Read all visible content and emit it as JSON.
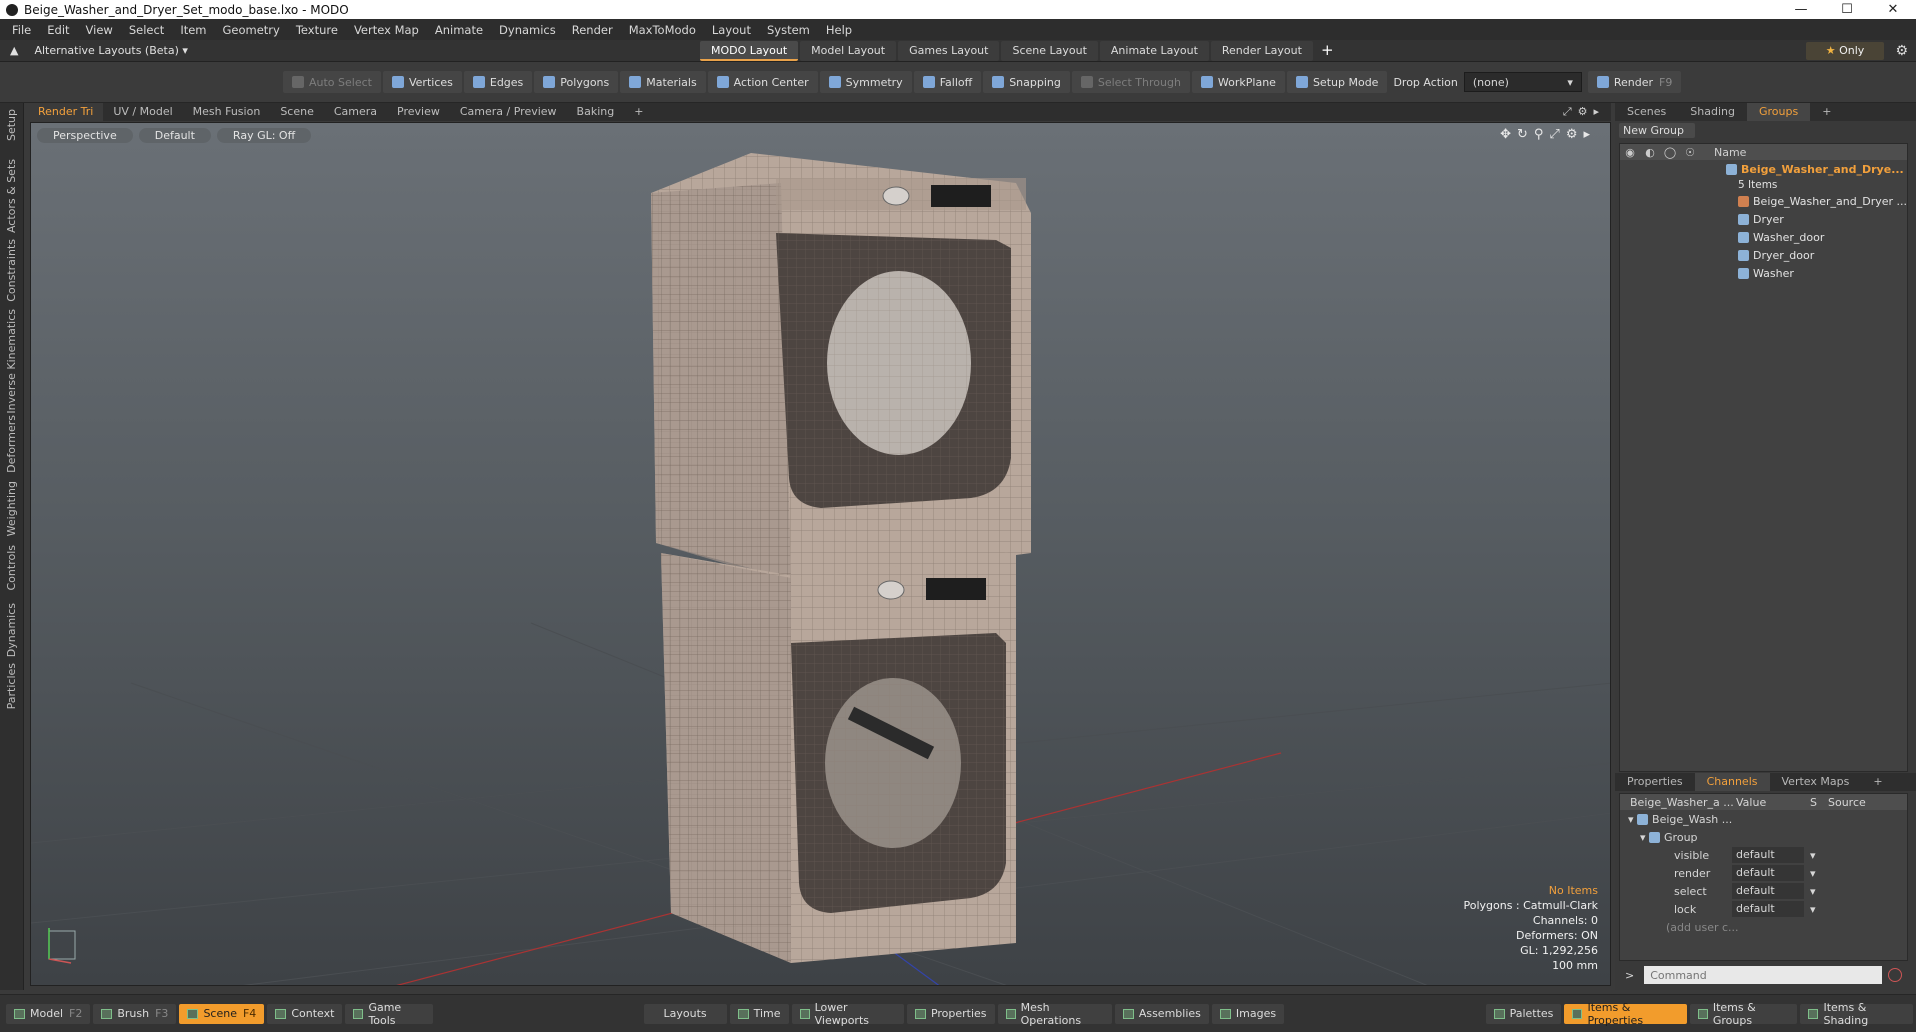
{
  "window": {
    "title": "Beige_Washer_and_Dryer_Set_modo_base.lxo - MODO"
  },
  "menu": [
    "File",
    "Edit",
    "View",
    "Select",
    "Item",
    "Geometry",
    "Texture",
    "Vertex Map",
    "Animate",
    "Dynamics",
    "Render",
    "MaxToModo",
    "Layout",
    "System",
    "Help"
  ],
  "layoutbar": {
    "alt_label": "Alternative Layouts (Beta)",
    "tabs": [
      "MODO Layout",
      "Model Layout",
      "Games Layout",
      "Scene Layout",
      "Animate Layout",
      "Render Layout"
    ],
    "plus": "+",
    "only_label": "Only"
  },
  "toolbar": {
    "auto_select": "Auto Select",
    "vertices": "Vertices",
    "edges": "Edges",
    "polygons": "Polygons",
    "materials": "Materials",
    "action_center": "Action Center",
    "symmetry": "Symmetry",
    "falloff": "Falloff",
    "snapping": "Snapping",
    "select_through": "Select Through",
    "workplane": "WorkPlane",
    "setup_mode": "Setup Mode",
    "drop_action_label": "Drop Action",
    "drop_action_value": "(none)",
    "render": "Render",
    "render_key": "F9"
  },
  "left_tabs": [
    "Setup",
    "Actors & Sets",
    "Constraints",
    "Inverse Kinematics",
    "Deformers",
    "Weighting",
    "Controls",
    "Dynamics",
    "Particles"
  ],
  "viewport_tabs": [
    "Render Tri",
    "UV / Model",
    "Mesh Fusion",
    "Scene",
    "Camera",
    "Preview",
    "Camera / Preview",
    "Baking"
  ],
  "viewport": {
    "view_mode": "Perspective",
    "shading": "Default",
    "raygl": "Ray GL: Off",
    "stats": {
      "selection": "No Items",
      "polygons": "Polygons : Catmull-Clark",
      "channels": "Channels: 0",
      "deformers": "Deformers: ON",
      "gl": "GL: 1,292,256",
      "scale": "100 mm"
    }
  },
  "right_panel": {
    "tabs": [
      "Scenes",
      "Shading",
      "Groups"
    ],
    "new_group": "New Group",
    "name_header": "Name",
    "group_name": "Beige_Washer_and_Drye...",
    "group_count": "5 Items",
    "items": [
      "Beige_Washer_and_Dryer ...",
      "Dryer",
      "Washer_door",
      "Dryer_door",
      "Washer"
    ],
    "channel_tabs": [
      "Properties",
      "Channels",
      "Vertex Maps"
    ],
    "channel_head": {
      "name": "Beige_Washer_a ...",
      "value": "Value",
      "s": "S",
      "source": "Source"
    },
    "channel_item": "Beige_Wash ...",
    "channel_group": "Group",
    "channels": [
      {
        "name": "visible",
        "value": "default"
      },
      {
        "name": "render",
        "value": "default"
      },
      {
        "name": "select",
        "value": "default"
      },
      {
        "name": "lock",
        "value": "default"
      }
    ],
    "add_user": "(add user c...",
    "command_placeholder": "Command"
  },
  "statusbar": {
    "left": [
      {
        "label": "Model",
        "key": "F2"
      },
      {
        "label": "Brush",
        "key": "F3"
      },
      {
        "label": "Scene",
        "key": "F4"
      },
      {
        "label": "Context",
        "key": ""
      },
      {
        "label": "Game Tools",
        "key": ""
      }
    ],
    "middle": [
      "Layouts",
      "Time",
      "Lower Viewports",
      "Properties",
      "Mesh Operations",
      "Assemblies",
      "Images"
    ],
    "right": [
      "Palettes",
      "Items & Properties",
      "Items & Groups",
      "Items & Shading"
    ]
  }
}
